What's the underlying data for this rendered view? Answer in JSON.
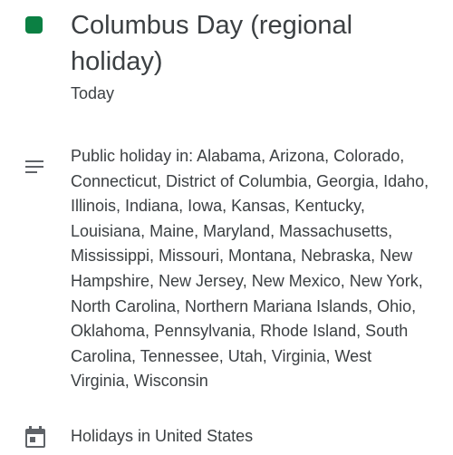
{
  "event": {
    "title": "Columbus Day (regional holiday)",
    "date": "Today",
    "color": "#0b8043",
    "description": "Public holiday in: Alabama, Arizona, Colorado, Connecticut, District of Columbia, Georgia, Idaho, Illinois, Indiana, Iowa, Kansas, Kentucky, Louisiana, Maine, Maryland, Massachusetts, Mississippi, Missouri, Montana, Nebraska, New Hampshire, New Jersey, New Mexico, New York, North Carolina, Northern Mariana Islands, Ohio, Oklahoma, Pennsylvania, Rhode Island, South Carolina, Tennessee, Utah, Virginia, West Virginia, Wisconsin",
    "calendar": "Holidays in United States"
  },
  "icons": {
    "color_swatch": "color-swatch",
    "description": "notes-icon",
    "calendar": "calendar-icon"
  }
}
